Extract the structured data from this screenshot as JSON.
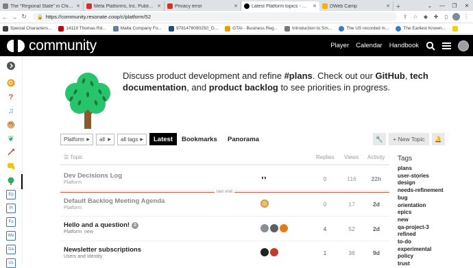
{
  "browser": {
    "tabs": [
      {
        "title": "The \"Regional State\" in Chile's",
        "color": "#7f7f7f"
      },
      {
        "title": "Meta Platforms, Inc. Publisher",
        "color": "#d93025"
      },
      {
        "title": "Privacy error",
        "color": "#d93025"
      },
      {
        "title": "Latest Platform topics - Resonate",
        "color": "#000000",
        "active": true
      },
      {
        "title": "DWeb Camp",
        "color": "#f2b400"
      }
    ],
    "url": "https://community.resonate.coop/c/platform/52",
    "bookmarks": [
      {
        "label": "Special Characters...",
        "color": "#3c4043"
      },
      {
        "label": "14119 Thomas Rd...",
        "color": "#c00000"
      },
      {
        "label": "Malta Company Fo...",
        "color": "#5b7fa6"
      },
      {
        "label": "9781478090250_O...",
        "color": "#1f4e79"
      },
      {
        "label": "GTAI - Business Reg...",
        "color": "#e8a000"
      },
      {
        "label": "Introduction to Sm...",
        "color": "#777777"
      },
      {
        "label": "The US recorded m...",
        "color": "#2f7cd6"
      },
      {
        "label": "The Earliest Known...",
        "color": "#2f7cd6"
      }
    ]
  },
  "site": {
    "logo_text": "community",
    "nav": [
      "Player",
      "Calendar",
      "Handbook"
    ]
  },
  "banner": {
    "t1": "Discuss product development and refine ",
    "b1": "#plans",
    "t2": ". Check out our ",
    "b2": "GitHub",
    "t3": ", ",
    "b3": "tech documentation",
    "t4": ", and ",
    "b4": "product backlog",
    "t5": " to see priorities in progress."
  },
  "filters": {
    "category": "Platform",
    "subcategory": "all",
    "tags": "all tags",
    "tabs": [
      "Latest",
      "Bookmarks",
      "Panorama"
    ],
    "new_topic": "+ New Topic"
  },
  "table": {
    "headers": {
      "topic": "Topic",
      "replies": "Replies",
      "views": "Views",
      "activity": "Activity"
    },
    "last_visit": "last visit",
    "rows": [
      {
        "title": "Dev Decisions Log",
        "category": "Platform",
        "tag": "",
        "badge": "",
        "replies": "0",
        "views": "116",
        "activity": "22h",
        "read": true
      },
      {
        "title": "Default Backlog Meeting Agenda",
        "category": "Platform",
        "tag": "",
        "badge": "",
        "replies": "0",
        "views": "17",
        "activity": "2d",
        "read": true
      },
      {
        "title": "Hello and a question!",
        "category": "Platform",
        "tag": "new",
        "badge": "2",
        "replies": "4",
        "views": "52",
        "activity": "2d",
        "read": false
      },
      {
        "title": "Newsletter subscriptions",
        "category": "Users and Identity",
        "tag": "",
        "badge": "",
        "replies": "1",
        "views": "36",
        "activity": "9d",
        "read": false
      }
    ]
  },
  "tags_sidebar": {
    "heading": "Tags",
    "items": [
      "plans",
      "user-stories",
      "design",
      "needs-refinement",
      "bug",
      "orientation",
      "epics",
      "new",
      "qa-project-3",
      "refined",
      "to-do",
      "experimental",
      "policy",
      "trust"
    ]
  },
  "sidebar": {
    "tag_items": [
      "Ep",
      "Pl",
      "Fo",
      "We",
      "Da",
      "Us"
    ]
  }
}
